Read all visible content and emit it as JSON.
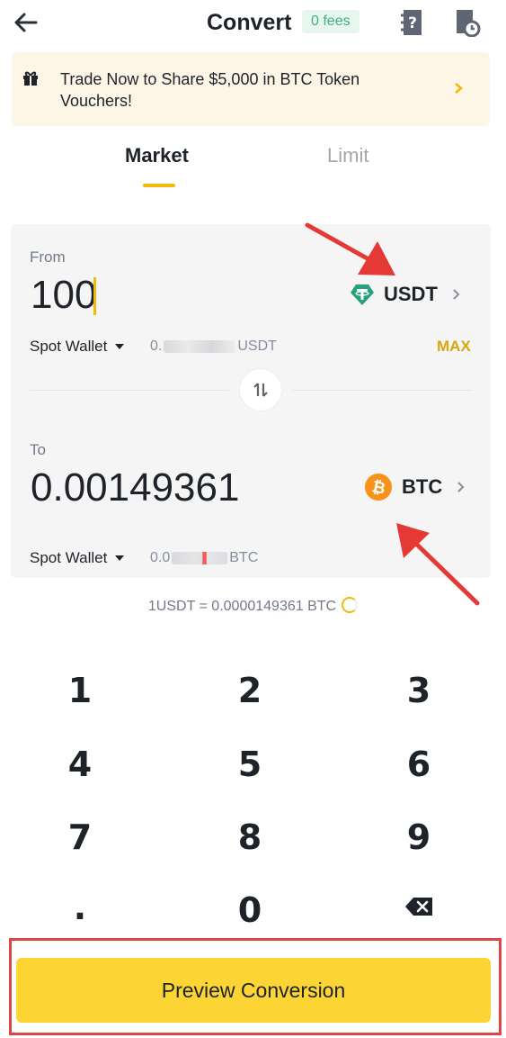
{
  "header": {
    "title": "Convert",
    "fees_badge": "0 fees",
    "icons": [
      "back-arrow-icon",
      "guide-icon",
      "history-icon"
    ]
  },
  "banner": {
    "text": "Trade Now to Share $5,000 in BTC Token Vouchers!",
    "icon": "gift-icon"
  },
  "tabs": [
    {
      "label": "Market",
      "active": true
    },
    {
      "label": "Limit",
      "active": false
    }
  ],
  "from": {
    "label": "From",
    "amount": "100",
    "coin": "USDT",
    "wallet": "Spot Wallet",
    "balance_prefix": "0.",
    "balance_suffix": "USDT",
    "max_label": "MAX"
  },
  "to": {
    "label": "To",
    "amount": "0.00149361",
    "coin": "BTC",
    "wallet": "Spot Wallet",
    "balance_prefix": "0.0",
    "balance_suffix": "BTC"
  },
  "rate": "1USDT = 0.0000149361 BTC",
  "keypad": [
    {
      "label": "1"
    },
    {
      "label": "2"
    },
    {
      "label": "3"
    },
    {
      "label": "4"
    },
    {
      "label": "5"
    },
    {
      "label": "6"
    },
    {
      "label": "7"
    },
    {
      "label": "8"
    },
    {
      "label": "9"
    },
    {
      "label": "."
    },
    {
      "label": "0"
    },
    {
      "label": "",
      "icon": "backspace-icon"
    }
  ],
  "cta": {
    "label": "Preview Conversion"
  },
  "colors": {
    "accent_yellow": "#fcd535",
    "tab_underline": "#f0b90b",
    "max_text": "#d9a60c",
    "fees_green": "#3bb47a",
    "usdt_green": "#26a17b",
    "btc_orange": "#f7931a",
    "annotation_red": "#e04343"
  }
}
